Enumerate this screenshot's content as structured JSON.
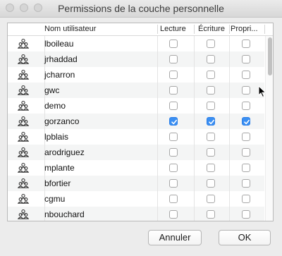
{
  "window": {
    "title": "Permissions de la couche personnelle"
  },
  "table": {
    "headers": {
      "user": "Nom utilisateur",
      "read": "Lecture",
      "write": "Écriture",
      "owner": "Propri..."
    },
    "rows": [
      {
        "user": "lboileau",
        "read": false,
        "write": false,
        "owner": false
      },
      {
        "user": "jrhaddad",
        "read": false,
        "write": false,
        "owner": false
      },
      {
        "user": "jcharron",
        "read": false,
        "write": false,
        "owner": false
      },
      {
        "user": "gwc",
        "read": false,
        "write": false,
        "owner": false
      },
      {
        "user": "demo",
        "read": false,
        "write": false,
        "owner": false
      },
      {
        "user": "gorzanco",
        "read": true,
        "write": true,
        "owner": true
      },
      {
        "user": "lpblais",
        "read": false,
        "write": false,
        "owner": false
      },
      {
        "user": "arodriguez",
        "read": false,
        "write": false,
        "owner": false
      },
      {
        "user": "mplante",
        "read": false,
        "write": false,
        "owner": false
      },
      {
        "user": "bfortier",
        "read": false,
        "write": false,
        "owner": false
      },
      {
        "user": "cgmu",
        "read": false,
        "write": false,
        "owner": false
      },
      {
        "user": "nbouchard",
        "read": false,
        "write": false,
        "owner": false
      }
    ]
  },
  "buttons": {
    "cancel": "Annuler",
    "ok": "OK"
  },
  "icons": {
    "user": "user-group-icon"
  },
  "colors": {
    "checked": "#3b8ff2"
  }
}
